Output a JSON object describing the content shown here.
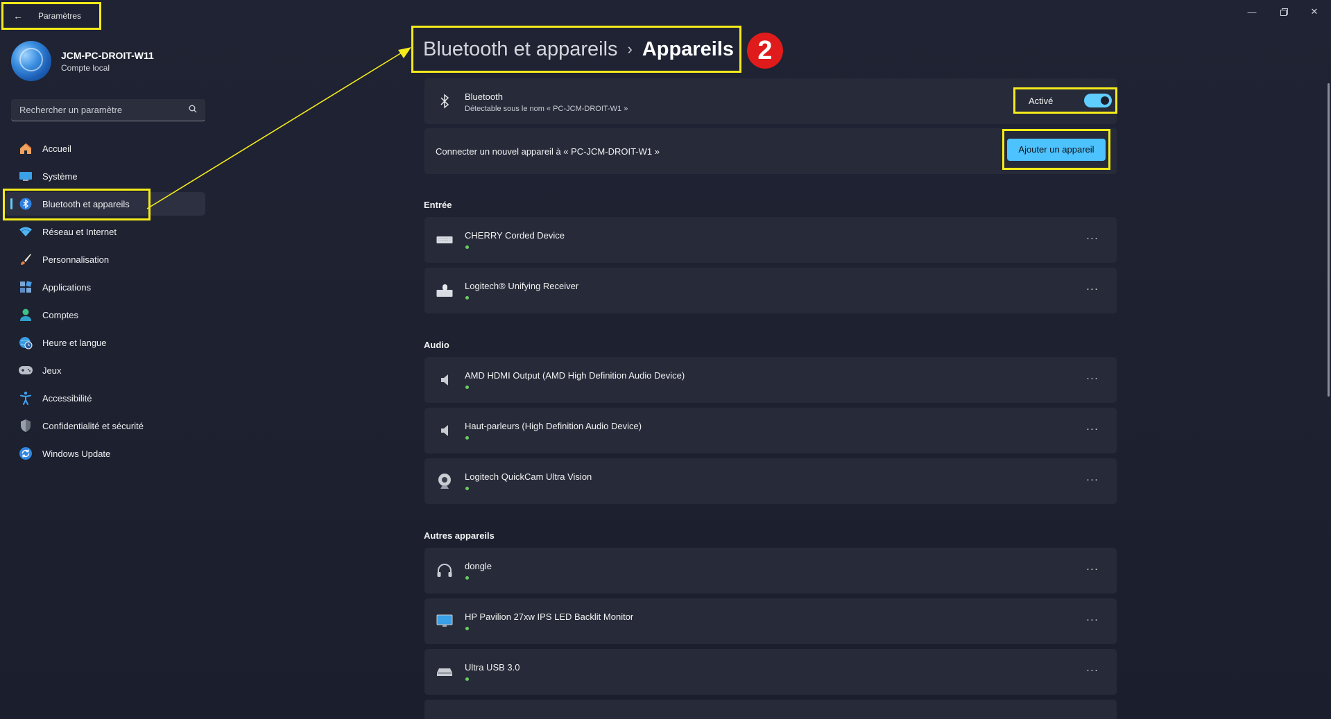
{
  "window": {
    "title": "Paramètres"
  },
  "profile": {
    "name": "JCM-PC-DROIT-W11",
    "account_type": "Compte local"
  },
  "search": {
    "placeholder": "Rechercher un paramètre"
  },
  "nav": {
    "items": [
      {
        "label": "Accueil",
        "icon": "home-icon"
      },
      {
        "label": "Système",
        "icon": "monitor-icon"
      },
      {
        "label": "Bluetooth et appareils",
        "icon": "bluetooth-icon",
        "selected": true
      },
      {
        "label": "Réseau et Internet",
        "icon": "wifi-icon"
      },
      {
        "label": "Personnalisation",
        "icon": "brush-icon"
      },
      {
        "label": "Applications",
        "icon": "apps-icon"
      },
      {
        "label": "Comptes",
        "icon": "person-icon"
      },
      {
        "label": "Heure et langue",
        "icon": "globe-clock-icon"
      },
      {
        "label": "Jeux",
        "icon": "gamepad-icon"
      },
      {
        "label": "Accessibilité",
        "icon": "accessibility-icon"
      },
      {
        "label": "Confidentialité et sécurité",
        "icon": "shield-icon"
      },
      {
        "label": "Windows Update",
        "icon": "sync-icon"
      }
    ]
  },
  "header": {
    "parent": "Bluetooth et appareils",
    "separator": "›",
    "current": "Appareils"
  },
  "annotation": {
    "step": "2",
    "highlight_color": "#f5eb1a",
    "badge_color": "#e01b1b"
  },
  "bluetooth": {
    "title": "Bluetooth",
    "subtitle": "Détectable sous le nom « PC-JCM-DROIT-W1 »",
    "state_label": "Activé"
  },
  "connect": {
    "label": "Connecter un nouvel appareil à « PC-JCM-DROIT-W1 »",
    "button": "Ajouter un appareil"
  },
  "sections": [
    {
      "title": "Entrée",
      "devices": [
        {
          "name": "CHERRY Corded Device",
          "icon": "keyboard-icon"
        },
        {
          "name": "Logitech® Unifying Receiver",
          "icon": "keyboard-mouse-icon"
        }
      ]
    },
    {
      "title": "Audio",
      "devices": [
        {
          "name": "AMD HDMI Output (AMD High Definition Audio Device)",
          "icon": "speaker-icon"
        },
        {
          "name": "Haut-parleurs (High Definition Audio Device)",
          "icon": "speaker-icon"
        },
        {
          "name": "Logitech QuickCam Ultra Vision",
          "icon": "webcam-icon"
        }
      ]
    },
    {
      "title": "Autres appareils",
      "devices": [
        {
          "name": "dongle",
          "icon": "headset-icon"
        },
        {
          "name": "HP Pavilion 27xw IPS LED Backlit Monitor",
          "icon": "monitor-icon"
        },
        {
          "name": "Ultra USB 3.0",
          "icon": "drive-icon"
        }
      ]
    }
  ],
  "more_label": "···",
  "colors": {
    "accent": "#60cdff",
    "button": "#4cc2ff",
    "status_dot": "#6ccb5f",
    "card": "#272b39"
  }
}
